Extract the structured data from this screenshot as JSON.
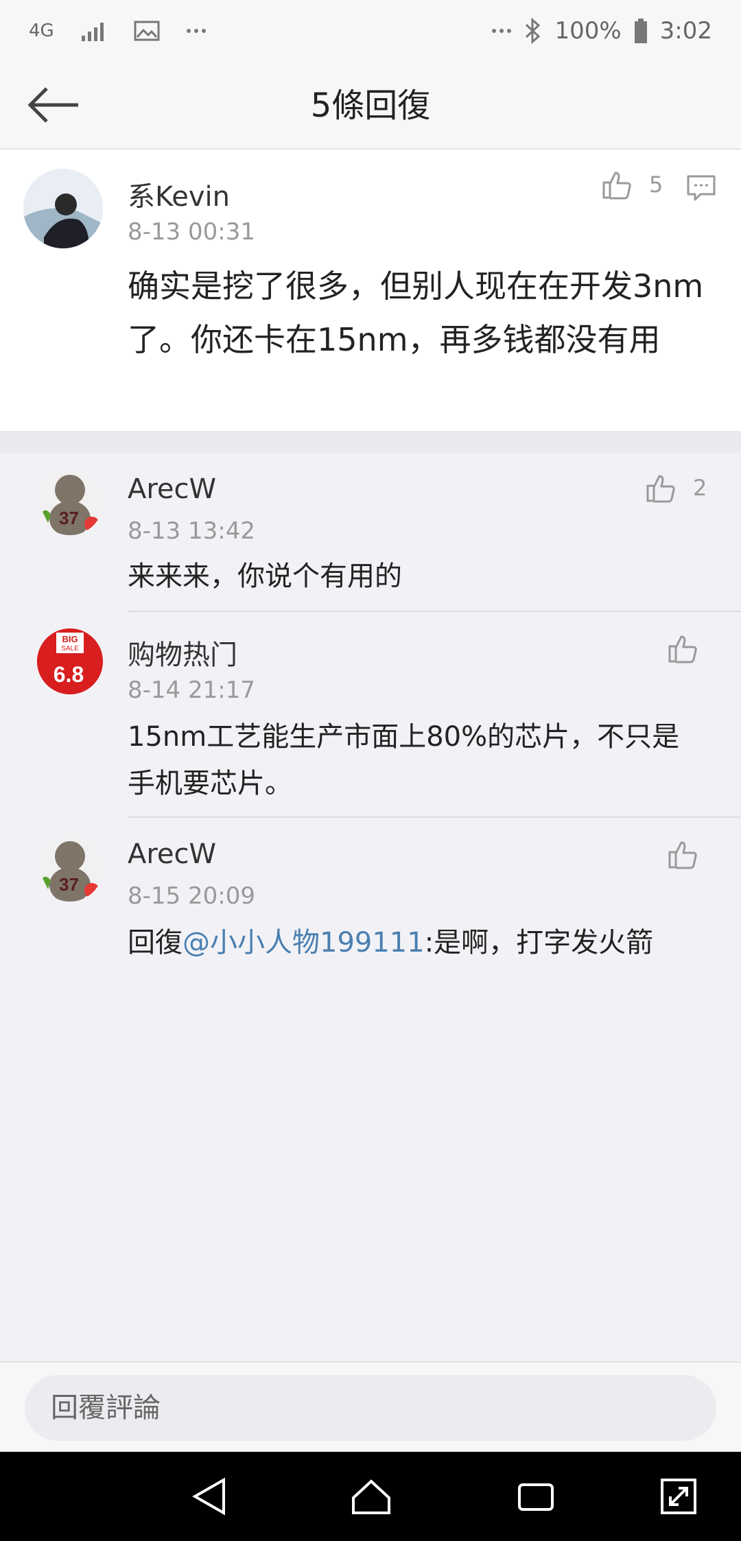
{
  "status_bar": {
    "network": "4G",
    "battery": "100%",
    "time": "3:02",
    "icons": [
      "signal-icon",
      "image-icon",
      "more-icon",
      "bluetooth-icon",
      "battery-icon"
    ]
  },
  "header": {
    "title": "5條回復"
  },
  "main_comment": {
    "username": "系Kevin",
    "time": "8-13 00:31",
    "content": "确实是挖了很多，但别人现在在开发3nm了。你还卡在15nm，再多钱都没有用",
    "like_count": "5"
  },
  "replies": [
    {
      "username": "ArecW",
      "time": "8-13 13:42",
      "content": "来来来，你说个有用的",
      "like_count": "2"
    },
    {
      "username": "购物热门",
      "time": "8-14 21:17",
      "content": "15nm工艺能生产市面上80%的芯片，不只是手机要芯片。",
      "like_count": ""
    },
    {
      "username": "ArecW",
      "time": "8-15 20:09",
      "reply_prefix": "回復",
      "mention": "@小小人物199111",
      "content": ":是啊，打字发火箭",
      "like_count": ""
    }
  ],
  "avatar_badges": {
    "arec_number": "37",
    "shop_big": "BIG",
    "shop_sale": "SALE",
    "shop_price": "6.8"
  },
  "reply_bar": {
    "placeholder": "回覆評論"
  },
  "colors": {
    "mention": "#4a7fb0",
    "time_gray": "#999999",
    "background": "#f2f2f6"
  }
}
